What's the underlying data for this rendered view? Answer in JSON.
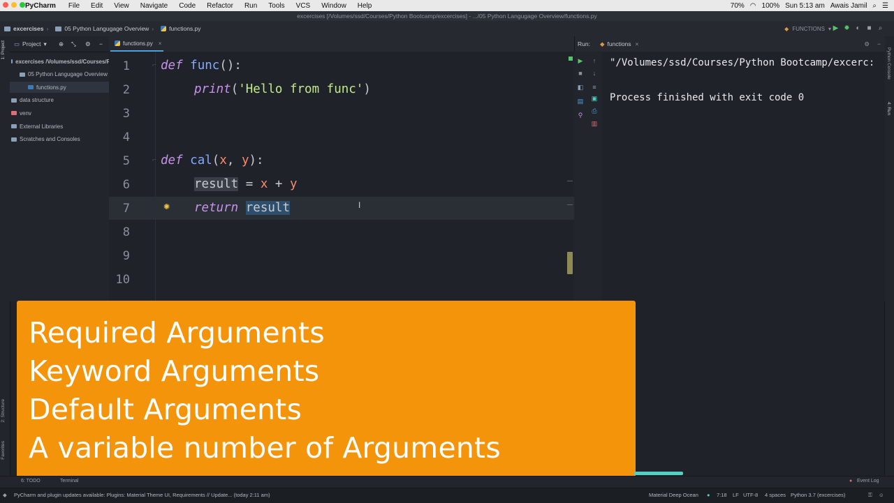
{
  "menubar": {
    "app": "PyCharm",
    "items": [
      "File",
      "Edit",
      "View",
      "Navigate",
      "Code",
      "Refactor",
      "Run",
      "Tools",
      "VCS",
      "Window",
      "Help"
    ],
    "battery": "70%",
    "wifi_batt": "100%",
    "time": "Sun 5:13 am",
    "user": "Awais Jamil"
  },
  "title": "excercises [/Volumes/ssd/Courses/Python Bootcamp/excercises] - .../05 Python Langugage Overview/functions.py",
  "breadcrumb": {
    "root": "excercises",
    "folder": "05 Python Langugage Overview",
    "file": "functions.py"
  },
  "run_config": "FUNCTIONS",
  "side_labels": {
    "project": "1: Project",
    "structure": "2: Structure",
    "favorites": "Favorites",
    "python_console": "Python Console",
    "run": "4: Run"
  },
  "project": {
    "header": "Project",
    "tree": [
      {
        "label": "excercises  /Volumes/ssd/Courses/P",
        "indent": 0,
        "bold": true
      },
      {
        "label": "05 Python Langugage Overview",
        "indent": 1
      },
      {
        "label": "functions.py",
        "indent": 2,
        "selected": true
      },
      {
        "label": "data structure",
        "indent": 0
      },
      {
        "label": "venv",
        "indent": 0
      },
      {
        "label": "External Libraries",
        "indent": 0
      },
      {
        "label": "Scratches and Consoles",
        "indent": 0
      }
    ]
  },
  "editor": {
    "tab": "functions.py",
    "line_numbers": [
      "1",
      "2",
      "3",
      "4",
      "5",
      "6",
      "7",
      "8",
      "9",
      "10"
    ],
    "code": {
      "l1_kw": "def",
      "l1_fn": "func",
      "l1_rest": "():",
      "l2_kw": "print",
      "l2_open": "(",
      "l2_str": "'Hello from func'",
      "l2_close": ")",
      "l5_kw": "def",
      "l5_fn": "cal",
      "l5_open": "(",
      "l5_x": "x",
      "l5_comma": ", ",
      "l5_y": "y",
      "l5_close": "):",
      "l6_var": "result",
      "l6_eq": " = ",
      "l6_x": "x",
      "l6_plus": " + ",
      "l6_y": "y",
      "l7_kw": "return",
      "l7_var": "result"
    }
  },
  "run": {
    "label": "Run:",
    "tab": "functions",
    "output": [
      "\"/Volumes/ssd/Courses/Python Bootcamp/excerc:",
      "",
      "Process finished with exit code 0"
    ]
  },
  "overlay": {
    "lines": [
      "Required Arguments",
      "Keyword Arguments",
      "Default Arguments",
      "A variable number of Arguments"
    ]
  },
  "toolwindows": {
    "todo": "6: TODO",
    "terminal": "Terminal",
    "event_log": "Event Log"
  },
  "status": {
    "message": "PyCharm and plugin updates available: Plugins: Material Theme UI, Requirements // Update... (today 2:11 am)",
    "theme": "Material Deep Ocean",
    "position": "7:18",
    "line_sep": "LF",
    "encoding": "UTF-8",
    "indent": "4 spaces",
    "interpreter": "Python 3.7 (excercises)"
  },
  "colors": {
    "overlay": "#f3940a",
    "keyword": "#c792ea",
    "function": "#82aaff",
    "string": "#c3e88d",
    "param": "#f78c6c"
  }
}
